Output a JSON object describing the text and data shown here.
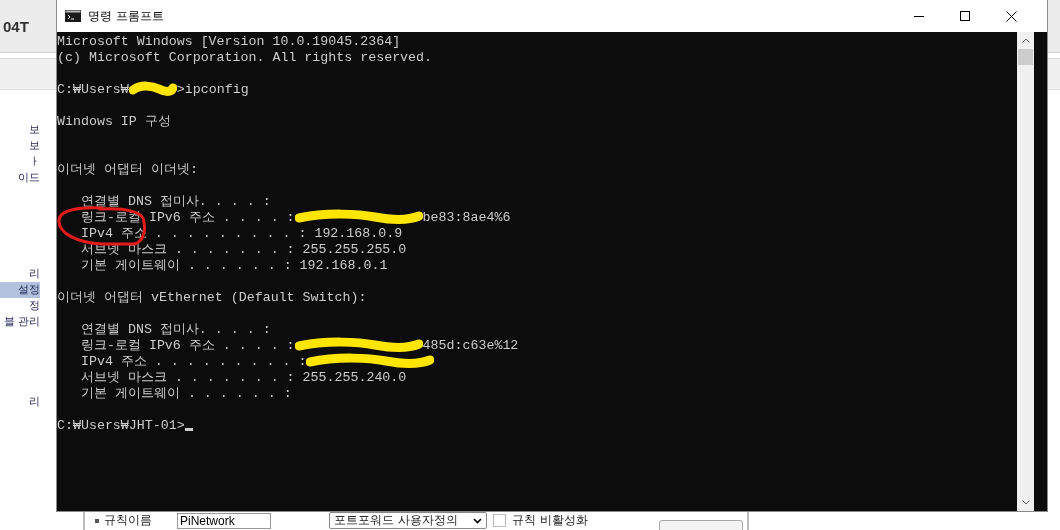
{
  "background_page": {
    "header_text": "04T",
    "sidebar_groups": [
      [
        {
          "label": "보",
          "selected": false
        },
        {
          "label": "보",
          "selected": false
        },
        {
          "label": "ㅏ",
          "selected": false
        },
        {
          "label": "이드",
          "selected": false
        }
      ],
      [
        {
          "label": "리",
          "selected": false
        },
        {
          "label": "설정",
          "selected": true
        },
        {
          "label": "정",
          "selected": false
        },
        {
          "label": "블 관리",
          "selected": false
        }
      ],
      [
        {
          "label": "리",
          "selected": false
        }
      ]
    ],
    "form": {
      "label": "규칙이름",
      "name_value": "PiNetwork",
      "type_value": "포트포워드 사용자정의",
      "disable_checkbox": {
        "label": "규칙 비활성화",
        "checked": false
      }
    }
  },
  "window": {
    "title": "명령 프롬프트",
    "circle_annotation": true,
    "console_lines": [
      {
        "kind": "plain",
        "text": "Microsoft Windows [Version 10.0.19045.2364]"
      },
      {
        "kind": "plain",
        "text": "(c) Microsoft Corporation. All rights reserved."
      },
      {
        "kind": "blank"
      },
      {
        "kind": "prompt-redacted",
        "before": "C:₩Users₩",
        "after": ">ipconfig"
      },
      {
        "kind": "blank"
      },
      {
        "kind": "plain",
        "text": "Windows IP 구성"
      },
      {
        "kind": "blank"
      },
      {
        "kind": "blank"
      },
      {
        "kind": "plain",
        "text": "이더넷 어댑터 이더넷:"
      },
      {
        "kind": "blank"
      },
      {
        "kind": "plain",
        "text": "   연결별 DNS 접미사. . . . :"
      },
      {
        "kind": "value-redacted",
        "before": "   링크-로컬 IPv6 주소 . . . . :",
        "after": "be83:8ae4%6"
      },
      {
        "kind": "plain",
        "text": "   IPv4 주소 . . . . . . . . . : 192.168.0.9"
      },
      {
        "kind": "plain",
        "text": "   서브넷 마스크 . . . . . . . : 255.255.255.0"
      },
      {
        "kind": "plain",
        "text": "   기본 게이트웨이 . . . . . . : 192.168.0.1"
      },
      {
        "kind": "blank"
      },
      {
        "kind": "plain",
        "text": "이더넷 어댑터 vEthernet (Default Switch):"
      },
      {
        "kind": "blank"
      },
      {
        "kind": "plain",
        "text": "   연결별 DNS 접미사. . . . :"
      },
      {
        "kind": "value-redacted",
        "before": "   링크-로컬 IPv6 주소 . . . . :",
        "after": "485d:c63e%12"
      },
      {
        "kind": "value-redacted",
        "before": "   IPv4 주소 . . . . . . . . . :"
      },
      {
        "kind": "plain",
        "text": "   서브넷 마스크 . . . . . . . : 255.255.240.0"
      },
      {
        "kind": "plain",
        "text": "   기본 게이트웨이 . . . . . . :"
      },
      {
        "kind": "blank"
      },
      {
        "kind": "prompt-cursor",
        "text": "C:₩Users₩JHT-01>"
      }
    ]
  }
}
